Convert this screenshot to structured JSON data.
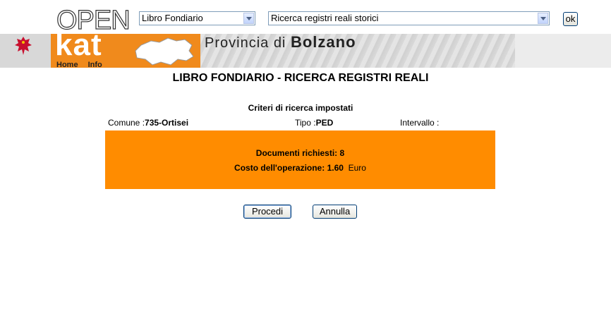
{
  "header": {
    "logo_open": "OPEN",
    "logo_kat": "kat",
    "provincia_prefix": "Provincia di",
    "provincia_name": "Bolzano",
    "nav": {
      "home": "Home",
      "info": "Info"
    },
    "section_select": "Libro Fondiario",
    "search_select": "Ricerca registri reali storici",
    "ok_label": "ok",
    "accent_color": "#f08a1c"
  },
  "page": {
    "title": "LIBRO FONDIARIO - RICERCA REGISTRI REALI",
    "criteria_heading": "Criteri di ricerca impostati",
    "comune_label": "Comune :",
    "comune_value": "735-Ortisei",
    "tipo_label": "Tipo :",
    "tipo_value": "PED",
    "intervallo_label": "Intervallo :",
    "intervallo_value": ""
  },
  "summary": {
    "documenti_label": "Documenti richiesti:",
    "documenti_value": "8",
    "costo_label": "Costo dell'operazione:",
    "costo_value": "1.60",
    "currency": "Euro",
    "panel_color": "#ff8c00"
  },
  "actions": {
    "procedi": "Procedi",
    "annulla": "Annulla"
  }
}
